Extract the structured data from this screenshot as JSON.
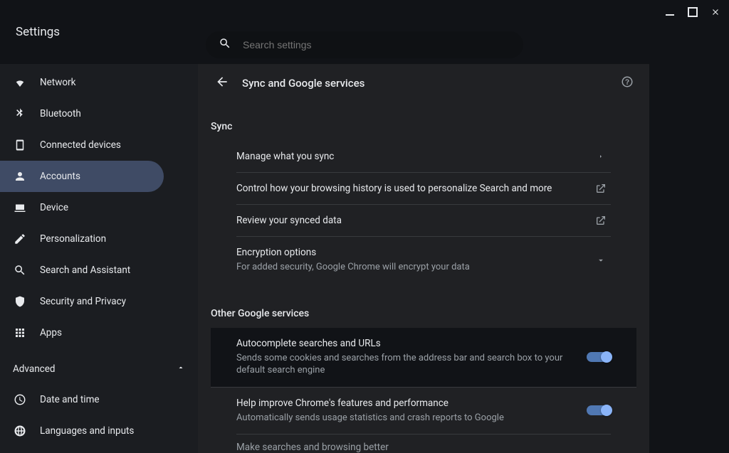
{
  "header": {
    "title": "Settings"
  },
  "search": {
    "placeholder": "Search settings"
  },
  "sidebar": {
    "items": [
      {
        "label": "Network"
      },
      {
        "label": "Bluetooth"
      },
      {
        "label": "Connected devices"
      },
      {
        "label": "Accounts"
      },
      {
        "label": "Device"
      },
      {
        "label": "Personalization"
      },
      {
        "label": "Search and Assistant"
      },
      {
        "label": "Security and Privacy"
      },
      {
        "label": "Apps"
      }
    ],
    "advanced_label": "Advanced",
    "advanced_items": [
      {
        "label": "Date and time"
      },
      {
        "label": "Languages and inputs"
      }
    ]
  },
  "page": {
    "title": "Sync and Google services",
    "sync_section": "Sync",
    "sync_rows": {
      "manage": "Manage what you sync",
      "control": "Control how your browsing history is used to personalize Search and more",
      "review": "Review your synced data",
      "encryption_title": "Encryption options",
      "encryption_sub": "For added security, Google Chrome will encrypt your data"
    },
    "other_section": "Other Google services",
    "other_rows": {
      "autocomplete_title": "Autocomplete searches and URLs",
      "autocomplete_sub": "Sends some cookies and searches from the address bar and search box to your default search engine",
      "improve_title": "Help improve Chrome's features and performance",
      "improve_sub": "Automatically sends usage statistics and crash reports to Google",
      "cutoff": "Make searches and browsing better"
    }
  }
}
